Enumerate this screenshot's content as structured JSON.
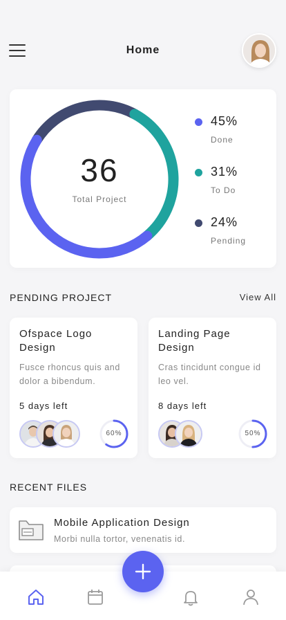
{
  "header": {
    "title": "Home"
  },
  "summary": {
    "total_value": "36",
    "total_label": "Total Project",
    "legend": [
      {
        "pct": "45%",
        "label": "Done",
        "value": 45,
        "color": "#5b63f0"
      },
      {
        "pct": "31%",
        "label": "To Do",
        "value": 31,
        "color": "#1fa39e"
      },
      {
        "pct": "24%",
        "label": "Pending",
        "value": 24,
        "color": "#414a70"
      }
    ]
  },
  "pending": {
    "title": "PENDING PROJECT",
    "view_all": "View All",
    "projects": [
      {
        "title": "Ofspace Logo Design",
        "desc": "Fusce rhoncus quis and dolor a bibendum.",
        "days": "5 days left",
        "progress_label": "60%",
        "progress": 0.6
      },
      {
        "title": "Landing Page Design",
        "desc": "Cras tincidunt congue id leo vel.",
        "days": "8 days left",
        "progress_label": "50%",
        "progress": 0.5
      }
    ]
  },
  "recent": {
    "title": "RECENT FILES",
    "files": [
      {
        "title": "Mobile Application Design",
        "sub": "Morbi nulla tortor, venenatis id."
      }
    ]
  },
  "tabbar": {
    "items": [
      "home-icon",
      "calendar-icon",
      "bell-icon",
      "user-icon"
    ],
    "fab": "plus-icon"
  },
  "colors": {
    "accent": "#5b63f0",
    "teal": "#1fa39e",
    "navy": "#414a70"
  }
}
